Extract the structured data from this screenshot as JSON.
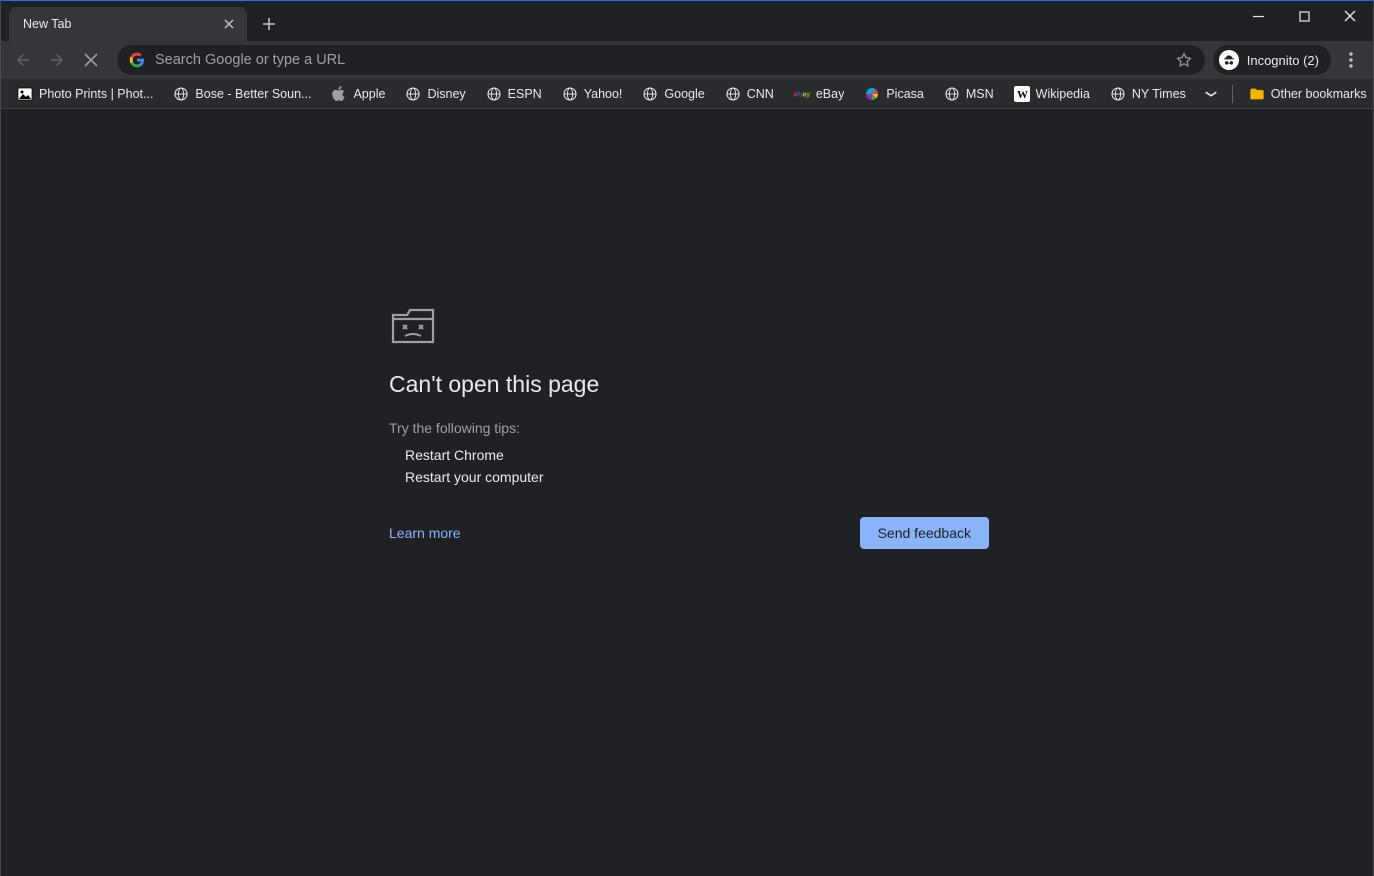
{
  "tab": {
    "title": "New Tab"
  },
  "omnibox": {
    "placeholder": "Search Google or type a URL"
  },
  "incognito": {
    "label": "Incognito (2)"
  },
  "bookmarks": [
    {
      "label": "Photo Prints | Phot...",
      "icon": "photo"
    },
    {
      "label": "Bose - Better Soun...",
      "icon": "globe"
    },
    {
      "label": "Apple",
      "icon": "apple"
    },
    {
      "label": "Disney",
      "icon": "globe"
    },
    {
      "label": "ESPN",
      "icon": "globe"
    },
    {
      "label": "Yahoo!",
      "icon": "globe"
    },
    {
      "label": "Google",
      "icon": "globe"
    },
    {
      "label": "CNN",
      "icon": "globe"
    },
    {
      "label": "eBay",
      "icon": "ebay"
    },
    {
      "label": "Picasa",
      "icon": "picasa"
    },
    {
      "label": "MSN",
      "icon": "globe"
    },
    {
      "label": "Wikipedia",
      "icon": "wiki"
    },
    {
      "label": "NY Times",
      "icon": "globe"
    }
  ],
  "other_bookmarks_label": "Other bookmarks",
  "error": {
    "title": "Can't open this page",
    "subtitle": "Try the following tips:",
    "tips": [
      "Restart Chrome",
      "Restart your computer"
    ],
    "learn_more": "Learn more",
    "feedback": "Send feedback"
  }
}
